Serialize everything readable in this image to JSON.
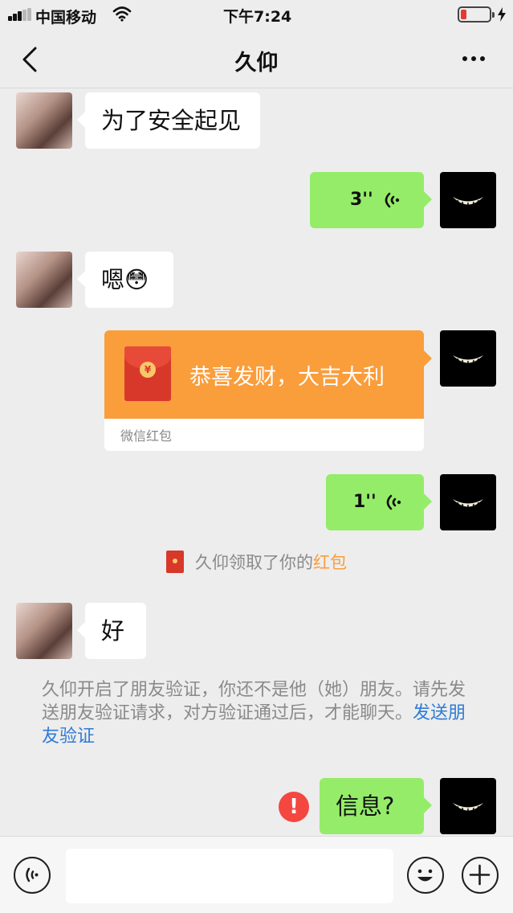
{
  "status_bar": {
    "carrier": "中国移动",
    "time": "下午7:24",
    "signal_bars": 5,
    "signal_active": 3,
    "battery_level": 0.15
  },
  "nav": {
    "title": "久仰"
  },
  "messages": [
    {
      "type": "text",
      "from": "contact",
      "text": "为了安全起见"
    },
    {
      "type": "voice",
      "from": "me",
      "duration": "3''"
    },
    {
      "type": "text",
      "from": "contact",
      "text": "嗯😳"
    },
    {
      "type": "red_packet",
      "from": "me",
      "greeting": "恭喜发财，大吉大利",
      "label": "微信红包",
      "coin": "¥"
    },
    {
      "type": "voice",
      "from": "me",
      "duration": "1''"
    },
    {
      "type": "text",
      "from": "contact",
      "text": "好"
    },
    {
      "type": "text",
      "from": "me",
      "text": "信息?",
      "failed": true,
      "error_mark": "!"
    }
  ],
  "system_notice": {
    "prefix": "久仰领取了你的",
    "link": "红包"
  },
  "verification": {
    "text": "久仰开启了朋友验证，你还不是他（她）朋友。请先发送朋友验证请求，对方验证通过后，才能聊天。",
    "link": "发送朋友验证"
  },
  "input_bar": {
    "placeholder": ""
  },
  "icons": {
    "back": "chevron-left-icon",
    "more": "more-dots-icon",
    "voice_mode": "voice-mode-icon",
    "emoji": "emoji-icon",
    "plus": "plus-icon",
    "voice_play": "voice-wave-icon"
  },
  "colors": {
    "background": "#ededed",
    "my_bubble": "#95ec69",
    "red_packet": "#fa9d3b",
    "link": "#2e7bd6",
    "error": "#f34740"
  }
}
